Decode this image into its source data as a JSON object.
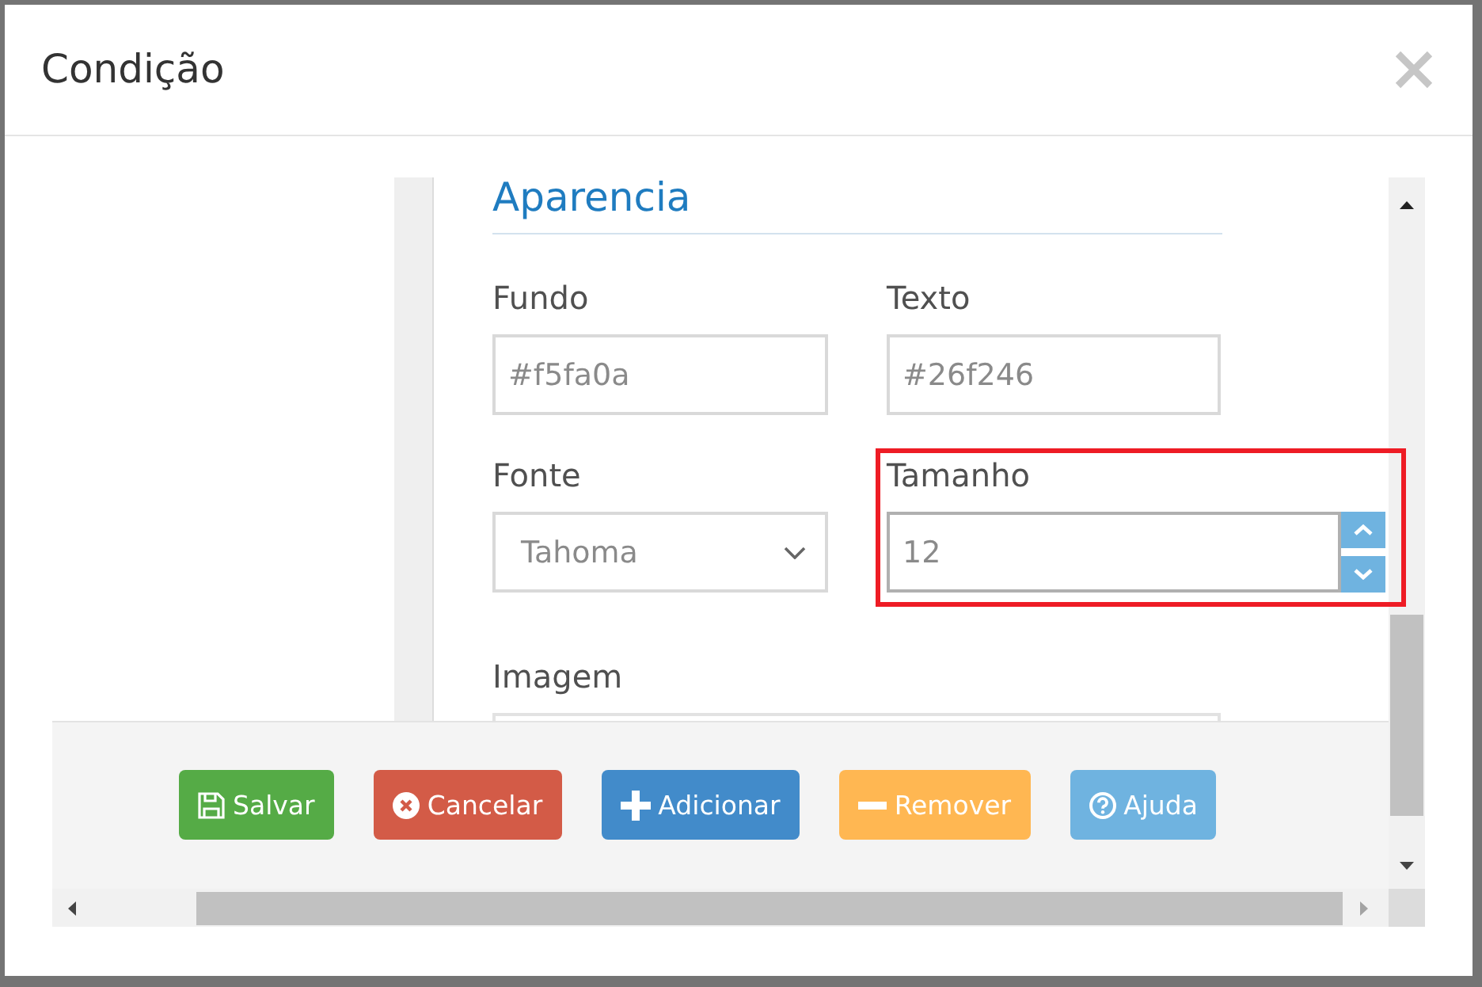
{
  "dialog": {
    "title": "Condição"
  },
  "appearance": {
    "heading": "Aparencia",
    "fields": [
      {
        "kind": "text",
        "label": "Fundo",
        "value": "#f5fa0a",
        "focused": false,
        "highlighted": false
      },
      {
        "kind": "text",
        "label": "Texto",
        "value": "#26f246",
        "focused": false,
        "highlighted": false
      },
      {
        "kind": "select",
        "label": "Fonte",
        "value": "Tahoma",
        "focused": false,
        "highlighted": false
      },
      {
        "kind": "number",
        "label": "Tamanho",
        "value": "12",
        "focused": true,
        "highlighted": true
      },
      {
        "kind": "partial",
        "label": "Imagem",
        "focused": false,
        "highlighted": false
      }
    ]
  },
  "buttons": [
    {
      "label": "Salvar",
      "kind": "save"
    },
    {
      "label": "Cancelar",
      "kind": "cancel"
    },
    {
      "label": "Adicionar",
      "kind": "add"
    },
    {
      "label": "Remover",
      "kind": "remove"
    },
    {
      "label": "Ajuda",
      "kind": "help"
    }
  ]
}
